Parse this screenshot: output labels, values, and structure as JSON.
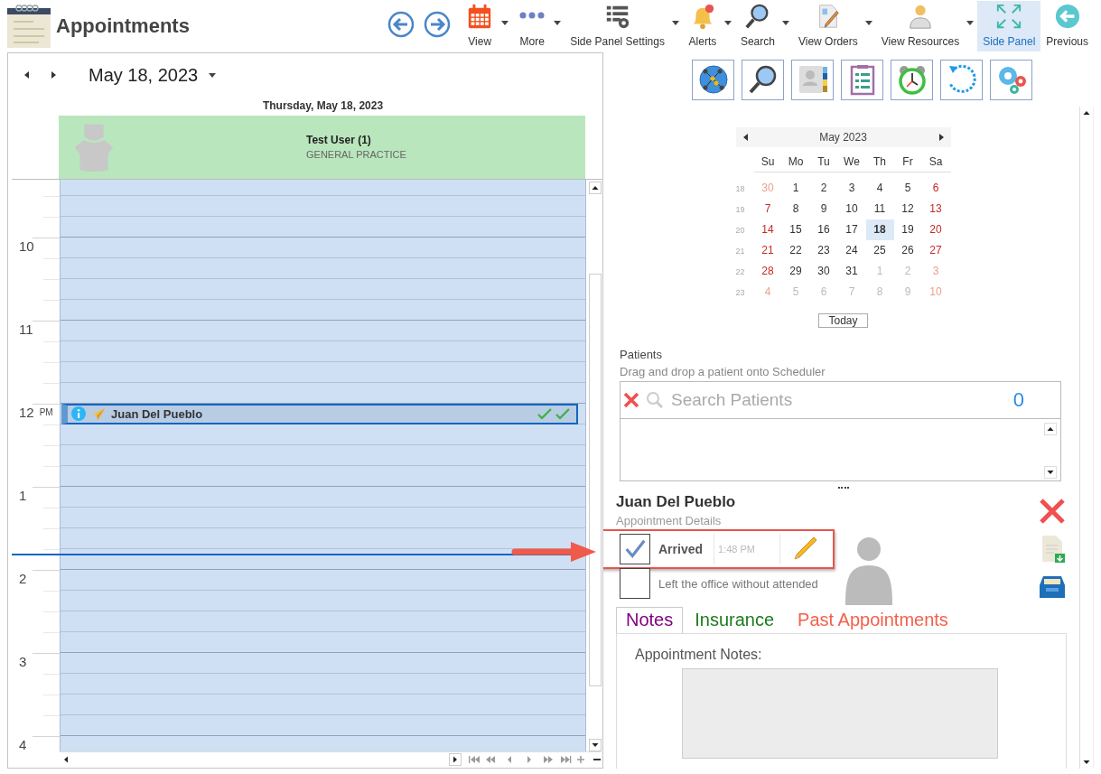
{
  "app": {
    "title": "Appointments"
  },
  "toolbar": [
    {
      "label": "View",
      "has_menu": true,
      "selected": false
    },
    {
      "label": "More",
      "has_menu": true,
      "selected": false
    },
    {
      "label": "Side Panel Settings",
      "has_menu": true,
      "selected": false
    },
    {
      "label": "Alerts",
      "has_menu": true,
      "selected": false
    },
    {
      "label": "Search",
      "has_menu": true,
      "selected": false
    },
    {
      "label": "View Orders",
      "has_menu": true,
      "selected": false
    },
    {
      "label": "View Resources",
      "has_menu": true,
      "selected": false
    },
    {
      "label": "Side Panel",
      "has_menu": false,
      "selected": true
    },
    {
      "label": "Previous",
      "has_menu": false,
      "selected": false
    }
  ],
  "scheduler": {
    "date": "May 18, 2023",
    "day_header": "Thursday, May 18, 2023",
    "resource": {
      "name": "Test User (1)",
      "specialty": "GENERAL PRACTICE"
    },
    "hours": [
      {
        "label": "10"
      },
      {
        "label": "11"
      },
      {
        "label": "12",
        "suffix": "PM",
        "appointments": [
          {
            "patient": "Juan Del Pueblo"
          }
        ]
      },
      {
        "label": "1",
        "now_line": true
      },
      {
        "label": "2"
      },
      {
        "label": "3"
      },
      {
        "label": "4"
      }
    ]
  },
  "side_panel": {
    "calendar": {
      "month": "May 2023",
      "weekdays": [
        "Su",
        "Mo",
        "Tu",
        "We",
        "Th",
        "Fr",
        "Sa"
      ],
      "weeks": [
        {
          "number": "18",
          "days": [
            {
              "label": "30",
              "muted": true,
              "weekend": true,
              "selected": false
            },
            {
              "label": "1",
              "muted": false,
              "weekend": false,
              "selected": false
            },
            {
              "label": "2",
              "muted": false,
              "weekend": false,
              "selected": false
            },
            {
              "label": "3",
              "muted": false,
              "weekend": false,
              "selected": false
            },
            {
              "label": "4",
              "muted": false,
              "weekend": false,
              "selected": false
            },
            {
              "label": "5",
              "muted": false,
              "weekend": false,
              "selected": false
            },
            {
              "label": "6",
              "muted": false,
              "weekend": true,
              "selected": false
            }
          ]
        },
        {
          "number": "19",
          "days": [
            {
              "label": "7",
              "muted": false,
              "weekend": true,
              "selected": false
            },
            {
              "label": "8",
              "muted": false,
              "weekend": false,
              "selected": false
            },
            {
              "label": "9",
              "muted": false,
              "weekend": false,
              "selected": false
            },
            {
              "label": "10",
              "muted": false,
              "weekend": false,
              "selected": false
            },
            {
              "label": "11",
              "muted": false,
              "weekend": false,
              "selected": false
            },
            {
              "label": "12",
              "muted": false,
              "weekend": false,
              "selected": false
            },
            {
              "label": "13",
              "muted": false,
              "weekend": true,
              "selected": false
            }
          ]
        },
        {
          "number": "20",
          "days": [
            {
              "label": "14",
              "muted": false,
              "weekend": true,
              "selected": false
            },
            {
              "label": "15",
              "muted": false,
              "weekend": false,
              "selected": false
            },
            {
              "label": "16",
              "muted": false,
              "weekend": false,
              "selected": false
            },
            {
              "label": "17",
              "muted": false,
              "weekend": false,
              "selected": false
            },
            {
              "label": "18",
              "muted": false,
              "weekend": false,
              "selected": true
            },
            {
              "label": "19",
              "muted": false,
              "weekend": false,
              "selected": false
            },
            {
              "label": "20",
              "muted": false,
              "weekend": true,
              "selected": false
            }
          ]
        },
        {
          "number": "21",
          "days": [
            {
              "label": "21",
              "muted": false,
              "weekend": true,
              "selected": false
            },
            {
              "label": "22",
              "muted": false,
              "weekend": false,
              "selected": false
            },
            {
              "label": "23",
              "muted": false,
              "weekend": false,
              "selected": false
            },
            {
              "label": "24",
              "muted": false,
              "weekend": false,
              "selected": false
            },
            {
              "label": "25",
              "muted": false,
              "weekend": false,
              "selected": false
            },
            {
              "label": "26",
              "muted": false,
              "weekend": false,
              "selected": false
            },
            {
              "label": "27",
              "muted": false,
              "weekend": true,
              "selected": false
            }
          ]
        },
        {
          "number": "22",
          "days": [
            {
              "label": "28",
              "muted": false,
              "weekend": true,
              "selected": false
            },
            {
              "label": "29",
              "muted": false,
              "weekend": false,
              "selected": false
            },
            {
              "label": "30",
              "muted": false,
              "weekend": false,
              "selected": false
            },
            {
              "label": "31",
              "muted": false,
              "weekend": false,
              "selected": false
            },
            {
              "label": "1",
              "muted": true,
              "weekend": false,
              "selected": false
            },
            {
              "label": "2",
              "muted": true,
              "weekend": false,
              "selected": false
            },
            {
              "label": "3",
              "muted": true,
              "weekend": true,
              "selected": false
            }
          ]
        },
        {
          "number": "23",
          "days": [
            {
              "label": "4",
              "muted": true,
              "weekend": true,
              "selected": false
            },
            {
              "label": "5",
              "muted": true,
              "weekend": false,
              "selected": false
            },
            {
              "label": "6",
              "muted": true,
              "weekend": false,
              "selected": false
            },
            {
              "label": "7",
              "muted": true,
              "weekend": false,
              "selected": false
            },
            {
              "label": "8",
              "muted": true,
              "weekend": false,
              "selected": false
            },
            {
              "label": "9",
              "muted": true,
              "weekend": false,
              "selected": false
            },
            {
              "label": "10",
              "muted": true,
              "weekend": true,
              "selected": false
            }
          ]
        }
      ]
    },
    "today_button": "Today",
    "patients": {
      "title": "Patients",
      "hint": "Drag and drop a patient onto Scheduler",
      "search": {
        "placeholder": "Search Patients"
      },
      "count": "0"
    },
    "appointment": {
      "patient": "Juan Del Pueblo",
      "subtitle": "Appointment Details",
      "options": [
        {
          "kind": "timed",
          "label": "Arrived",
          "checked": true,
          "time": "1:48 PM"
        },
        {
          "kind": "plain",
          "label": "Left the office without attended",
          "checked": false
        }
      ],
      "tabs": [
        {
          "label": "Notes",
          "selected": true,
          "color": "#800080"
        },
        {
          "label": "Insurance",
          "selected": false,
          "color": "#1e7a1e"
        },
        {
          "label": "Past Appointments",
          "selected": false,
          "color": "#f4604a"
        }
      ],
      "notes_label": "Appointment Notes:"
    }
  }
}
